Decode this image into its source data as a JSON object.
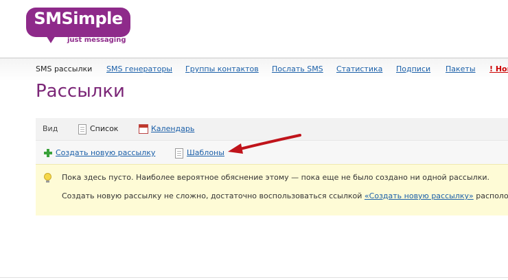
{
  "logo": {
    "name": "SMSimple",
    "tagline": "just messaging",
    "color": "#8e2a8a"
  },
  "nav": {
    "current": "SMS рассылки",
    "items": [
      "SMS генераторы",
      "Группы контактов",
      "Послать SMS",
      "Статистика",
      "Подписи",
      "Пакеты"
    ],
    "alert": "! Нов"
  },
  "page": {
    "title": "Рассылки"
  },
  "view": {
    "label": "Вид",
    "list": "Список",
    "calendar": "Календарь"
  },
  "actions": {
    "create": "Создать новую рассылку",
    "templates": "Шаблоны"
  },
  "notice": {
    "line1": "Пока здесь пусто. Наиболее вероятное обяснение этому — пока еще не было создано ни одной рассылки.",
    "line2_before": "Создать новую рассылку не сложно, достаточно воспользоваться ссылкой",
    "line2_link": "«Создать новую рассылку»",
    "line2_after": "располож"
  },
  "colors": {
    "accent": "#7b2677",
    "link": "#1a5fa8",
    "alert": "#cc0000",
    "notice_bg": "#fefbd6",
    "arrow": "#c0141b"
  }
}
